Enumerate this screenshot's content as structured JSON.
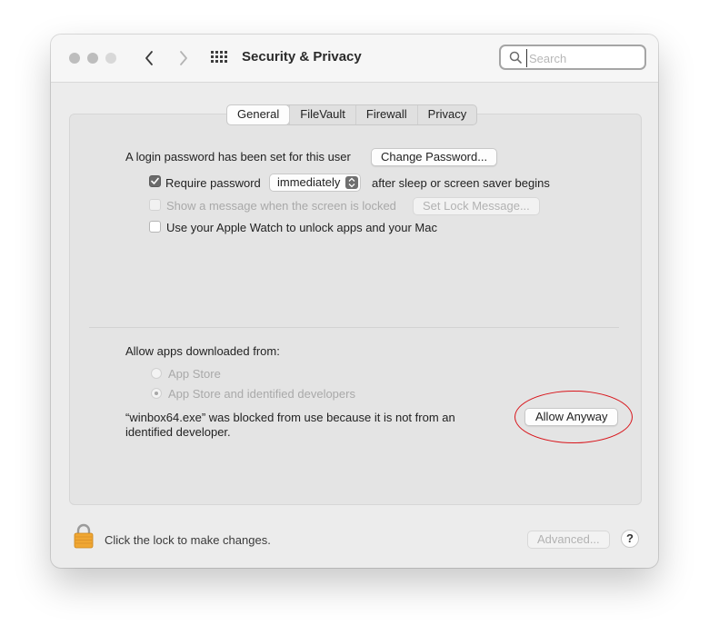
{
  "window": {
    "title": "Security & Privacy",
    "search": {
      "placeholder": "Search",
      "value": ""
    }
  },
  "tabs": [
    {
      "label": "General",
      "active": true
    },
    {
      "label": "FileVault",
      "active": false
    },
    {
      "label": "Firewall",
      "active": false
    },
    {
      "label": "Privacy",
      "active": false
    }
  ],
  "general": {
    "login_text": "A login password has been set for this user",
    "change_password_label": "Change Password...",
    "require_password": {
      "label": "Require password",
      "checked": true
    },
    "require_interval": "immediately",
    "after_sleep_text": "after sleep or screen saver begins",
    "show_message": {
      "label": "Show a message when the screen is locked",
      "checked": false,
      "enabled": false
    },
    "set_lock_message_label": "Set Lock Message...",
    "apple_watch": {
      "label": "Use your Apple Watch to unlock apps and your Mac",
      "checked": false
    }
  },
  "allow_apps": {
    "heading": "Allow apps downloaded from:",
    "options": [
      {
        "label": "App Store",
        "selected": false
      },
      {
        "label": "App Store and identified developers",
        "selected": true
      }
    ],
    "blocked_message_line1": "“winbox64.exe” was blocked from use because it is not from an",
    "blocked_message_line2": "identified developer.",
    "allow_anyway_label": "Allow Anyway"
  },
  "footer": {
    "lock_text": "Click the lock to make changes.",
    "advanced_label": "Advanced...",
    "help_label": "?"
  },
  "colors": {
    "highlight_circle": "#d8141a",
    "lock": "#f0a733"
  }
}
